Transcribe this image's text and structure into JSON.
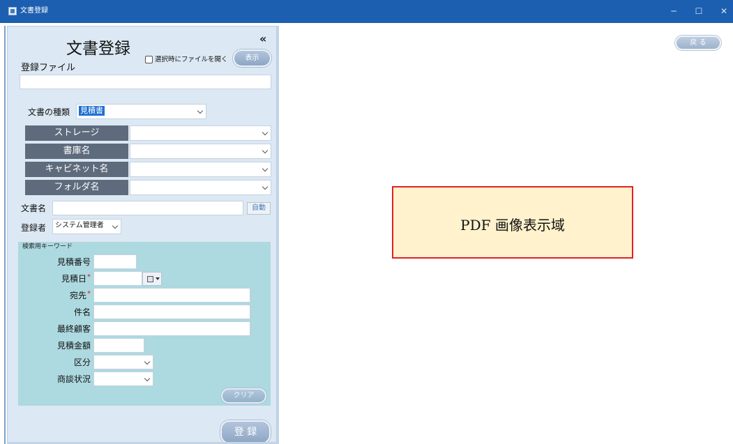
{
  "window": {
    "title": "文書登録",
    "controls": {
      "minimize": "─",
      "maximize": "☐",
      "close": "✕"
    }
  },
  "left_panel": {
    "heading": "文書登録",
    "collapse_icon": "«",
    "open_on_select_label": "選択時にファイルを開く",
    "open_on_select_checked": false,
    "show_button": "表示",
    "register_file_label": "登録ファイル",
    "register_file_value": "",
    "doc_type_label": "文書の種類",
    "doc_type_value": "見積書",
    "storage_label": "ストレージ",
    "library_label": "書庫名",
    "cabinet_label": "キャビネット名",
    "folder_label": "フォルダ名",
    "doc_name_label": "文書名",
    "doc_name_value": "",
    "auto_button": "自動",
    "registrant_label": "登録者",
    "registrant_value": "システム管理者",
    "keyword_section_title": "検索用キーワード",
    "keywords": {
      "estimate_no": "見積番号",
      "estimate_date": "見積日",
      "destination": "宛先",
      "subject": "件名",
      "final_customer": "最終顧客",
      "estimate_amount": "見積金額",
      "category": "区分",
      "negotiation_status": "商談状況",
      "required_mark": "*"
    },
    "clear_button": "クリア",
    "register_button": "登 録"
  },
  "right_area": {
    "back_button": "戻 る",
    "pdf_placeholder": "PDF 画像表示域"
  },
  "colors": {
    "titlebar": "#1c5fb0",
    "panel_bg": "#dce8f3",
    "dark_label": "#5e6b7c",
    "keyword_bg": "#add9e0",
    "pdf_box_fill": "#fff2cc",
    "pdf_box_border": "#e21f26"
  }
}
